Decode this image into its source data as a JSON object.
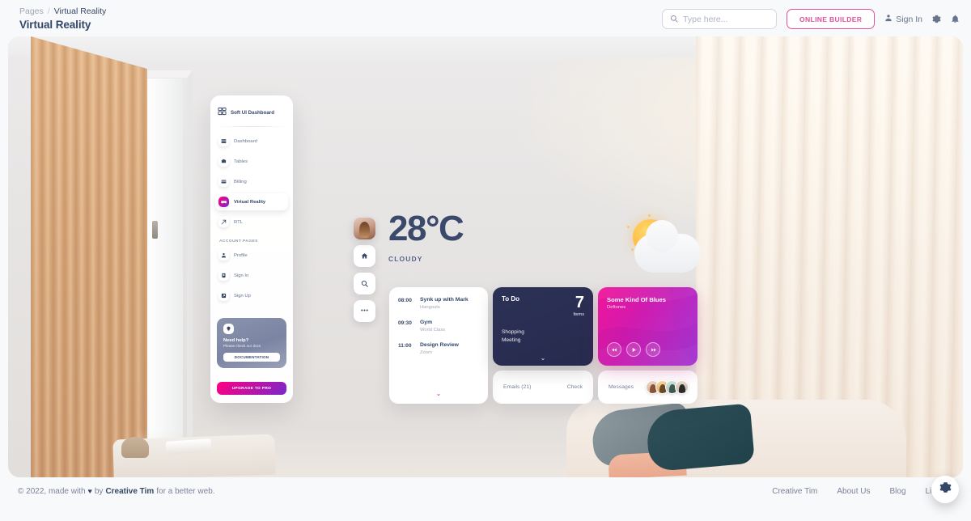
{
  "header": {
    "breadcrumb_root": "Pages",
    "breadcrumb_sep": "/",
    "breadcrumb_current": "Virtual Reality",
    "page_title": "Virtual Reality",
    "search_placeholder": "Type here...",
    "search_value": "",
    "online_builder_label": "ONLINE BUILDER",
    "signin_label": "Sign In",
    "accent_pink": "#e0529c"
  },
  "sidebar": {
    "brand": "Soft UI Dashboard",
    "items": [
      {
        "label": "Dashboard",
        "icon": "dashboard-icon",
        "active": false
      },
      {
        "label": "Tables",
        "icon": "tables-icon",
        "active": false
      },
      {
        "label": "Billing",
        "icon": "billing-icon",
        "active": false
      },
      {
        "label": "Virtual Reality",
        "icon": "vr-icon",
        "active": true
      },
      {
        "label": "RTL",
        "icon": "rtl-icon",
        "active": false
      }
    ],
    "section_label": "ACCOUNT PAGES",
    "account_items": [
      {
        "label": "Profile",
        "icon": "profile-icon"
      },
      {
        "label": "Sign In",
        "icon": "signin-icon"
      },
      {
        "label": "Sign Up",
        "icon": "signup-icon"
      }
    ],
    "help_title": "Need help?",
    "help_subtitle": "Please check our docs",
    "documentation_label": "DOCUMENTATION",
    "upgrade_label": "UPGRADE TO PRO",
    "active_color": "#ff0080"
  },
  "weather": {
    "temperature": "28°C",
    "condition": "CLOUDY",
    "icon": "sun-behind-cloud-icon"
  },
  "schedule": {
    "items": [
      {
        "time": "08:00",
        "title": "Synk up with Mark",
        "subtitle": "Hangouts"
      },
      {
        "time": "09:30",
        "title": "Gym",
        "subtitle": "World Class"
      },
      {
        "time": "11:00",
        "title": "Design Review",
        "subtitle": "Zoom"
      }
    ],
    "expand_icon": "chevron-down-icon"
  },
  "todo": {
    "title": "To Do",
    "count": "7",
    "count_unit": "Items",
    "entries": [
      "Shopping",
      "Meeting"
    ],
    "expand_icon": "chevron-down-icon"
  },
  "emails": {
    "label": "Emails (21)",
    "action": "Check"
  },
  "music": {
    "track": "Some Kind Of Blues",
    "artist": "Deftones",
    "controls": [
      "prev-icon",
      "play-icon",
      "next-icon"
    ]
  },
  "messages": {
    "label": "Messages",
    "avatar_count": 4
  },
  "footer": {
    "copyright_prefix": "© 2022, made with",
    "heart": "♥",
    "by": "by",
    "brand": "Creative Tim",
    "suffix": "for a better web.",
    "links": [
      "Creative Tim",
      "About Us",
      "Blog",
      "License"
    ],
    "settings_icon": "gear-icon"
  }
}
